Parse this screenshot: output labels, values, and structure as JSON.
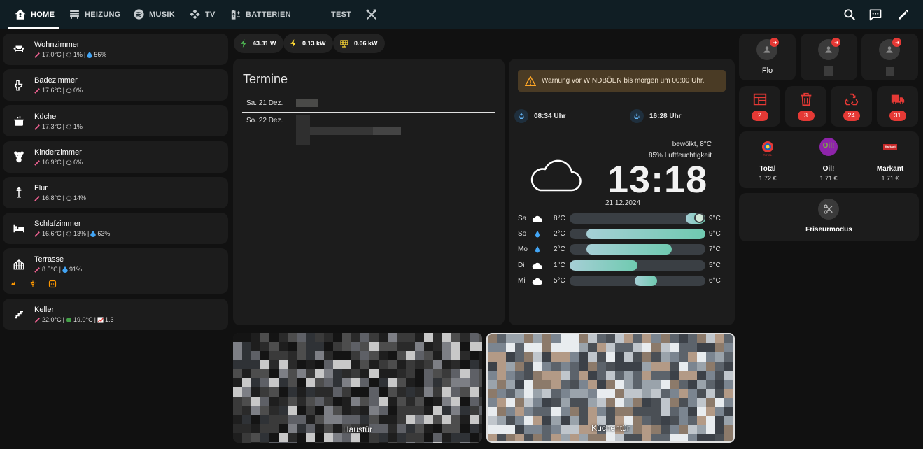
{
  "nav": {
    "tabs": [
      {
        "label": "HOME",
        "icon": "home-assistant-icon"
      },
      {
        "label": "HEIZUNG",
        "icon": "radiator-icon"
      },
      {
        "label": "MUSIK",
        "icon": "spotify-icon"
      },
      {
        "label": "TV",
        "icon": "kodi-icon"
      },
      {
        "label": "BATTERIEN",
        "icon": "battery-charging-icon"
      },
      {
        "label": "TEST",
        "icon": ""
      }
    ],
    "actions": [
      "search-icon",
      "assist-icon",
      "edit-icon"
    ]
  },
  "rooms": [
    {
      "name": "Wohnzimmer",
      "icon": "sofa-icon",
      "temp": "17.0°C",
      "fan": "1%",
      "humidity": "56%"
    },
    {
      "name": "Badezimmer",
      "icon": "toilet-icon",
      "temp": "17.6°C",
      "fan": "0%"
    },
    {
      "name": "Küche",
      "icon": "pot-icon",
      "temp": "17.3°C",
      "fan": "1%"
    },
    {
      "name": "Kinderzimmer",
      "icon": "teddy-bear-icon",
      "temp": "16.9°C",
      "fan": "6%"
    },
    {
      "name": "Flur",
      "icon": "coat-rack-icon",
      "temp": "16.8°C",
      "fan": "14%"
    },
    {
      "name": "Schlafzimmer",
      "icon": "bed-icon",
      "temp": "16.6°C",
      "fan": "13%",
      "humidity": "63%"
    },
    {
      "name": "Terrasse",
      "icon": "greenhouse-icon",
      "temp": "8.5°C",
      "humidity": "91%"
    },
    {
      "name": "Keller",
      "icon": "stairs-icon",
      "temp": "22.0°C",
      "temp2": "19.0°C",
      "value": "1.3"
    }
  ],
  "chips": [
    {
      "value": "43.31 W",
      "icon": "flash-icon",
      "color": "#4caf50"
    },
    {
      "value": "0.13 kW",
      "icon": "flash-icon",
      "color": "#fdd835"
    },
    {
      "value": "0.06 kW",
      "icon": "solar-panel-icon",
      "color": "#fdd835"
    }
  ],
  "termine": {
    "title": "Termine",
    "days": [
      "Sa. 21 Dez.",
      "So. 22 Dez."
    ]
  },
  "weather": {
    "warning": "Warnung vor WINDBÖEN bis morgen um 00:00 Uhr.",
    "sunrise": "08:34 Uhr",
    "sunset": "16:28 Uhr",
    "condition": "bewölkt, 8°C",
    "humidity": "85% Luftfeuchtigkeit",
    "time": "13:18",
    "date": "21.12.2024",
    "forecast": [
      {
        "day": "Sa",
        "icon": "cloud-icon",
        "low": "8°C",
        "high": "9°C",
        "low_value": 8,
        "high_value": 9,
        "current_value": 8
      },
      {
        "day": "So",
        "icon": "rain-drop-icon",
        "low": "2°C",
        "high": "9°C",
        "low_value": 2,
        "high_value": 9
      },
      {
        "day": "Mo",
        "icon": "rain-drop-icon",
        "low": "2°C",
        "high": "7°C",
        "low_value": 2,
        "high_value": 7
      },
      {
        "day": "Di",
        "icon": "cloud-icon",
        "low": "1°C",
        "high": "5°C",
        "low_value": 1,
        "high_value": 5
      },
      {
        "day": "Mi",
        "icon": "cloud-icon",
        "low": "5°C",
        "high": "6°C",
        "low_value": 5,
        "high_value": 6
      }
    ],
    "range": [
      1,
      9
    ]
  },
  "cameras": [
    {
      "label": "Haustür"
    },
    {
      "label": "Küchentür"
    }
  ],
  "persons": [
    {
      "name": "Flo"
    },
    {
      "name": ""
    },
    {
      "name": ""
    }
  ],
  "trash": [
    {
      "icon": "calendar-icon",
      "count": "2"
    },
    {
      "icon": "trash-can-icon",
      "count": "3"
    },
    {
      "icon": "recycle-icon",
      "count": "24"
    },
    {
      "icon": "truck-icon",
      "count": "31"
    }
  ],
  "fuel": [
    {
      "name": "Total",
      "price": "1.72 €",
      "logo_text": "TOTAL"
    },
    {
      "name": "Oil!",
      "price": "1.71 €",
      "logo_text": "Oil!"
    },
    {
      "name": "Markant",
      "price": "1.71 €",
      "logo_text": "Markant"
    }
  ],
  "friseur": {
    "label": "Friseurmodus",
    "icon": "scissors-icon"
  },
  "colors": {
    "accent_red": "#e53935",
    "warning_bg": "#4a3b25",
    "topbar": "#101e24",
    "bar_teal": "#6fcab0"
  }
}
